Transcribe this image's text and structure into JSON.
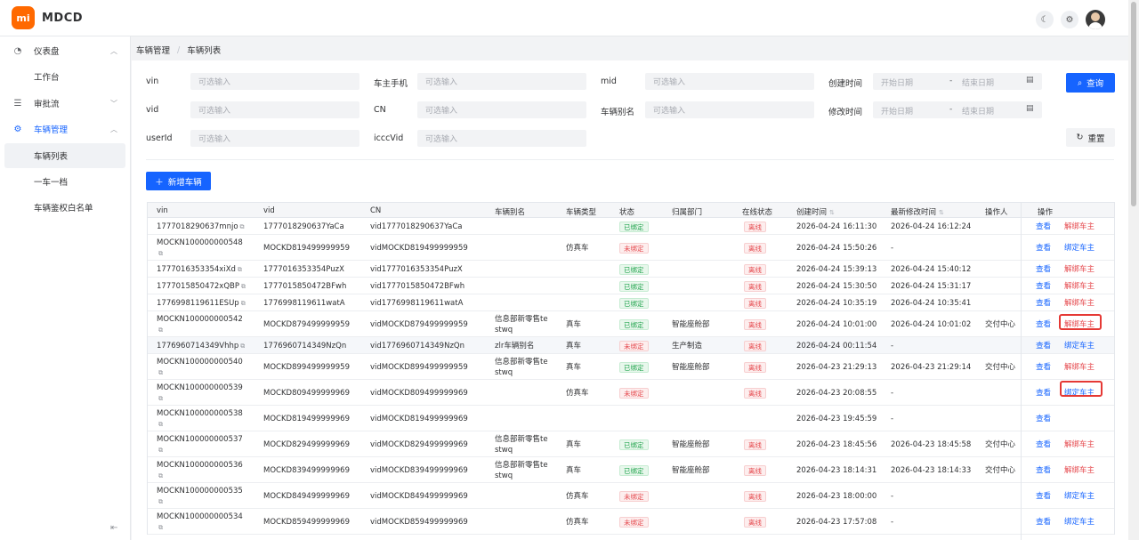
{
  "app": {
    "logo_text": "mi",
    "name": "MDCD",
    "brand_color": "#ff6900",
    "primary_color": "#1664ff"
  },
  "header": {
    "icons": [
      "moon-icon",
      "gear-icon",
      "avatar"
    ]
  },
  "sidebar": {
    "items": [
      {
        "label": "仪表盘",
        "icon": "dashboard-icon",
        "chevron": "⌃"
      },
      {
        "label": "工作台"
      },
      {
        "label": "审批流",
        "icon": "list-icon",
        "chevron": "⌄"
      },
      {
        "label": "车辆管理",
        "icon": "gear-icon",
        "chevron": "⌃"
      },
      {
        "label": "车辆列表"
      },
      {
        "label": "一车一档"
      },
      {
        "label": "车辆鉴权白名单"
      }
    ]
  },
  "breadcrumb": {
    "parent": "车辆管理",
    "sep": "/",
    "current": "车辆列表"
  },
  "filters": {
    "vin": {
      "label": "vin",
      "placeholder": "可选输入"
    },
    "owner_phone": {
      "label": "车主手机",
      "placeholder": "可选输入"
    },
    "mid": {
      "label": "mid",
      "placeholder": "可选输入"
    },
    "create_time": {
      "label": "创建时间",
      "start": "开始日期",
      "sep": "-",
      "end": "结束日期"
    },
    "vid": {
      "label": "vid",
      "placeholder": "可选输入"
    },
    "cn": {
      "label": "CN",
      "placeholder": "可选输入"
    },
    "alias": {
      "label": "车辆别名",
      "placeholder": "可选输入"
    },
    "modify_time": {
      "label": "修改时间",
      "start": "开始日期",
      "sep": "-",
      "end": "结束日期"
    },
    "userid": {
      "label": "userId",
      "placeholder": "可选输入"
    },
    "icccvid": {
      "label": "icccVid",
      "placeholder": "可选输入"
    },
    "query_label": "查询",
    "reset_label": "重置"
  },
  "add_button": "新增车辆",
  "table": {
    "headers": {
      "vin": "vin",
      "vid": "vid",
      "cn": "CN",
      "alias": "车辆别名",
      "type": "车辆类型",
      "status": "状态",
      "dept": "归属部门",
      "online": "在线状态",
      "created": "创建时间",
      "modified": "最新修改时间",
      "operator": "操作人",
      "action": "操作"
    },
    "rows": [
      {
        "vin": "1777018290637mnjo",
        "vid": "1777018290637YaCa",
        "cn": "vid1777018290637YaCa",
        "alias": "",
        "type": "",
        "status": "已绑定",
        "dept": "",
        "online": "离线",
        "created": "2026-04-24 16:11:30",
        "modified": "2026-04-24 16:12:24",
        "operator": "",
        "view": "查看",
        "action": "解绑车主"
      },
      {
        "vin": "MOCKN100000000548",
        "vid": "MOCKD819499999959",
        "cn": "vidMOCKD819499999959",
        "alias": "",
        "type": "仿真车",
        "status": "未绑定",
        "dept": "",
        "online": "离线",
        "created": "2026-04-24 15:50:26",
        "modified": "-",
        "operator": "",
        "view": "查看",
        "action": "绑定车主"
      },
      {
        "vin": "1777016353354xiXd",
        "vid": "1777016353354PuzX",
        "cn": "vid1777016353354PuzX",
        "alias": "",
        "type": "",
        "status": "已绑定",
        "dept": "",
        "online": "离线",
        "created": "2026-04-24 15:39:13",
        "modified": "2026-04-24 15:40:12",
        "operator": "",
        "view": "查看",
        "action": "解绑车主"
      },
      {
        "vin": "1777015850472xQBP",
        "vid": "1777015850472BFwh",
        "cn": "vid1777015850472BFwh",
        "alias": "",
        "type": "",
        "status": "已绑定",
        "dept": "",
        "online": "离线",
        "created": "2026-04-24 15:30:50",
        "modified": "2026-04-24 15:31:17",
        "operator": "",
        "view": "查看",
        "action": "解绑车主"
      },
      {
        "vin": "1776998119611ESUp",
        "vid": "1776998119611watA",
        "cn": "vid1776998119611watA",
        "alias": "",
        "type": "",
        "status": "已绑定",
        "dept": "",
        "online": "离线",
        "created": "2026-04-24 10:35:19",
        "modified": "2026-04-24 10:35:41",
        "operator": "",
        "view": "查看",
        "action": "解绑车主"
      },
      {
        "vin": "MOCKN100000000542",
        "vid": "MOCKD879499999959",
        "cn": "vidMOCKD879499999959",
        "alias": "信息部新零售testwq",
        "type": "真车",
        "status": "已绑定",
        "dept": "智能座舱部",
        "online": "离线",
        "created": "2026-04-24 10:01:00",
        "modified": "2026-04-24 10:01:02",
        "operator": "交付中心",
        "view": "查看",
        "action": "解绑车主"
      },
      {
        "vin": "1776960714349Vhhp",
        "vid": "1776960714349NzQn",
        "cn": "vid1776960714349NzQn",
        "alias": "zlr车辆别名",
        "type": "真车",
        "status": "未绑定",
        "dept": "生产制造",
        "online": "离线",
        "created": "2026-04-24 00:11:54",
        "modified": "-",
        "operator": "",
        "view": "查看",
        "action": "绑定车主"
      },
      {
        "vin": "MOCKN100000000540",
        "vid": "MOCKD899499999959",
        "cn": "vidMOCKD899499999959",
        "alias": "信息部新零售testwq",
        "type": "真车",
        "status": "已绑定",
        "dept": "智能座舱部",
        "online": "离线",
        "created": "2026-04-23 21:29:13",
        "modified": "2026-04-23 21:29:14",
        "operator": "交付中心",
        "view": "查看",
        "action": "解绑车主"
      },
      {
        "vin": "MOCKN100000000539",
        "vid": "MOCKD809499999969",
        "cn": "vidMOCKD809499999969",
        "alias": "",
        "type": "仿真车",
        "status": "未绑定",
        "dept": "",
        "online": "离线",
        "created": "2026-04-23 20:08:55",
        "modified": "-",
        "operator": "",
        "view": "查看",
        "action": "绑定车主"
      },
      {
        "vin": "MOCKN100000000538",
        "vid": "MOCKD819499999969",
        "cn": "vidMOCKD819499999969",
        "alias": "",
        "type": "",
        "status": "",
        "dept": "",
        "online": "",
        "created": "2026-04-23 19:45:59",
        "modified": "-",
        "operator": "",
        "view": "查看",
        "action": ""
      },
      {
        "vin": "MOCKN100000000537",
        "vid": "MOCKD829499999969",
        "cn": "vidMOCKD829499999969",
        "alias": "信息部新零售testwq",
        "type": "真车",
        "status": "已绑定",
        "dept": "智能座舱部",
        "online": "离线",
        "created": "2026-04-23 18:45:56",
        "modified": "2026-04-23 18:45:58",
        "operator": "交付中心",
        "view": "查看",
        "action": "解绑车主"
      },
      {
        "vin": "MOCKN100000000536",
        "vid": "MOCKD839499999969",
        "cn": "vidMOCKD839499999969",
        "alias": "信息部新零售testwq",
        "type": "真车",
        "status": "已绑定",
        "dept": "智能座舱部",
        "online": "离线",
        "created": "2026-04-23 18:14:31",
        "modified": "2026-04-23 18:14:33",
        "operator": "交付中心",
        "view": "查看",
        "action": "解绑车主"
      },
      {
        "vin": "MOCKN100000000535",
        "vid": "MOCKD849499999969",
        "cn": "vidMOCKD849499999969",
        "alias": "",
        "type": "仿真车",
        "status": "未绑定",
        "dept": "",
        "online": "离线",
        "created": "2026-04-23 18:00:00",
        "modified": "-",
        "operator": "",
        "view": "查看",
        "action": "绑定车主"
      },
      {
        "vin": "MOCKN100000000534",
        "vid": "MOCKD859499999969",
        "cn": "vidMOCKD859499999969",
        "alias": "",
        "type": "仿真车",
        "status": "未绑定",
        "dept": "",
        "online": "离线",
        "created": "2026-04-23 17:57:08",
        "modified": "-",
        "operator": "",
        "view": "查看",
        "action": "绑定车主"
      }
    ]
  }
}
